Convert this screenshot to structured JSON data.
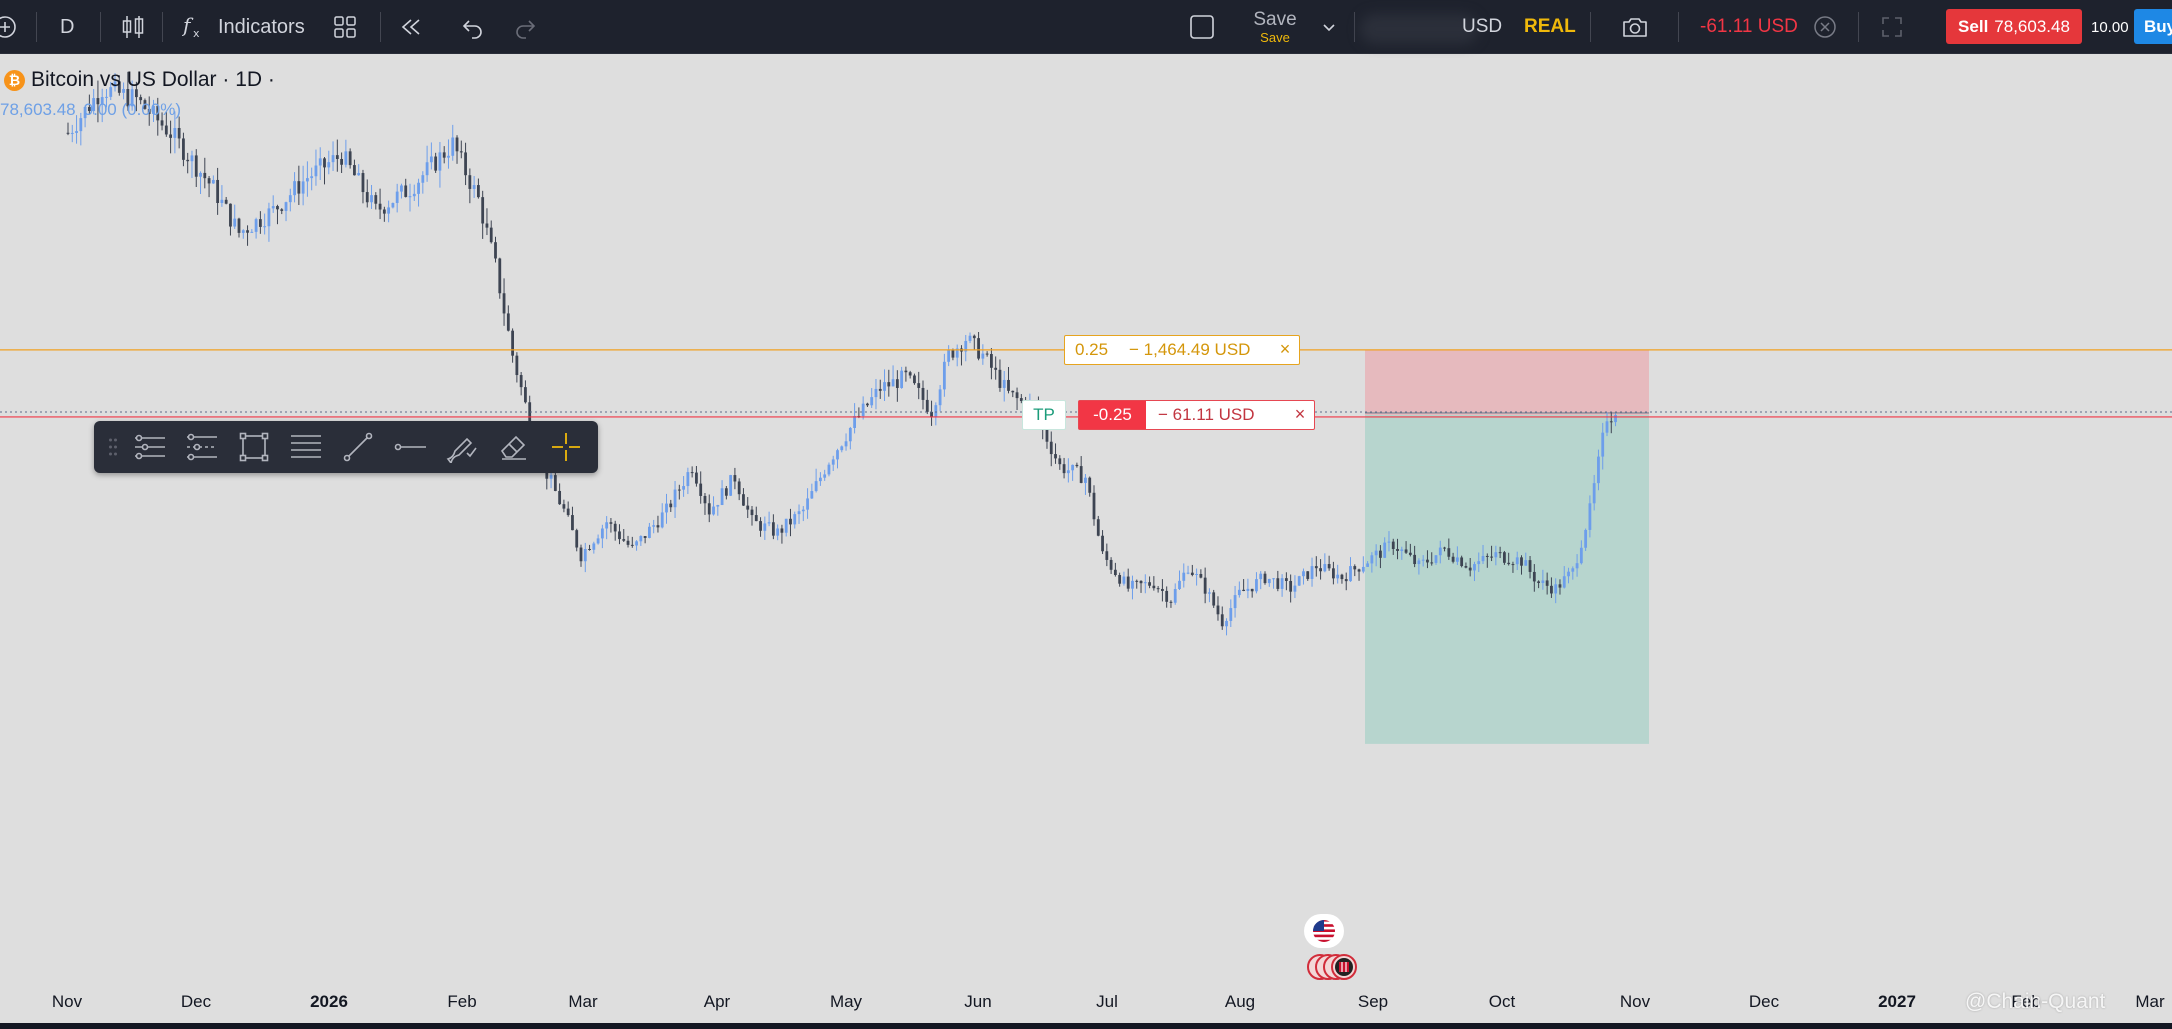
{
  "toolbar": {
    "timeframe": "D",
    "indicators_label": "Indicators",
    "save_label": "Save",
    "save_sublabel": "Save",
    "balance_suffix": "USD",
    "account_mode": "REAL",
    "pnl": "-61.11 USD",
    "sell_label": "Sell",
    "sell_price": "78,603.48",
    "lot": "10.00",
    "buy_label": "Buy"
  },
  "legend": {
    "title": "Bitcoin vs US Dollar · 1D ·",
    "coin_glyph": "₿",
    "price": "78,603.48",
    "change": "0.00 (0.00%)"
  },
  "orders": {
    "stop": {
      "qty": "0.25",
      "pnl": "− 1,464.49 USD",
      "close": "×"
    },
    "position": {
      "tag": "TP",
      "qty": "-0.25",
      "pnl": "− 61.11 USD",
      "close": "×"
    }
  },
  "colors": {
    "background": "#dedede",
    "toolbar": "#1e222d",
    "candle_up": "#6d9eeb",
    "candle_down": "#3d4452",
    "stop_line": "#f0a020",
    "position_line": "#f23645",
    "loss_zone": "#e8b4b8",
    "profit_zone": "#b3d4cc"
  },
  "drawing_tools": [
    "channel-icon",
    "pitchfork-icon",
    "rectangle-icon",
    "fib-icon",
    "trend-line-icon",
    "ray-icon",
    "brush-icon",
    "eraser-icon",
    "crosshair-icon"
  ],
  "events": {
    "flag": "us-flag-icon"
  },
  "watermark": "@Chain-Quant",
  "chart_data": {
    "type": "candlestick",
    "x_ticks": [
      {
        "label": "Nov",
        "bold": false
      },
      {
        "label": "Dec",
        "bold": false
      },
      {
        "label": "2026",
        "bold": true
      },
      {
        "label": "Feb",
        "bold": false
      },
      {
        "label": "Mar",
        "bold": false
      },
      {
        "label": "Apr",
        "bold": false
      },
      {
        "label": "May",
        "bold": false
      },
      {
        "label": "Jun",
        "bold": false
      },
      {
        "label": "Jul",
        "bold": false
      },
      {
        "label": "Aug",
        "bold": false
      },
      {
        "label": "Sep",
        "bold": false
      },
      {
        "label": "Oct",
        "bold": false
      },
      {
        "label": "Nov",
        "bold": false
      },
      {
        "label": "Dec",
        "bold": false
      },
      {
        "label": "2027",
        "bold": true
      },
      {
        "label": "Feb",
        "bold": false
      },
      {
        "label": "Mar",
        "bold": false
      }
    ],
    "path": [
      [
        0,
        104000
      ],
      [
        8,
        108000
      ],
      [
        16,
        107000
      ],
      [
        24,
        104000
      ],
      [
        34,
        99000
      ],
      [
        40,
        95000
      ],
      [
        48,
        97000
      ],
      [
        56,
        100000
      ],
      [
        64,
        102000
      ],
      [
        72,
        97000
      ],
      [
        80,
        99000
      ],
      [
        90,
        103000
      ],
      [
        96,
        98000
      ],
      [
        100,
        92000
      ],
      [
        104,
        84000
      ],
      [
        110,
        75000
      ],
      [
        116,
        70000
      ],
      [
        120,
        66000
      ],
      [
        126,
        69000
      ],
      [
        132,
        66500
      ],
      [
        140,
        70000
      ],
      [
        146,
        74000
      ],
      [
        150,
        70000
      ],
      [
        156,
        73000
      ],
      [
        160,
        69000
      ],
      [
        166,
        68000
      ],
      [
        172,
        70000
      ],
      [
        178,
        74500
      ],
      [
        184,
        78000
      ],
      [
        190,
        81000
      ],
      [
        196,
        82000
      ],
      [
        202,
        79000
      ],
      [
        206,
        84000
      ],
      [
        210,
        85500
      ],
      [
        214,
        84000
      ],
      [
        220,
        80500
      ],
      [
        226,
        79000
      ],
      [
        232,
        74000
      ],
      [
        238,
        73000
      ],
      [
        242,
        66000
      ],
      [
        248,
        63000
      ],
      [
        254,
        63500
      ],
      [
        258,
        62000
      ],
      [
        262,
        65000
      ],
      [
        266,
        63000
      ],
      [
        270,
        60000
      ],
      [
        274,
        62500
      ],
      [
        280,
        64000
      ],
      [
        286,
        63000
      ],
      [
        292,
        65000
      ],
      [
        298,
        64000
      ],
      [
        304,
        65500
      ],
      [
        310,
        67000
      ],
      [
        316,
        65000
      ],
      [
        322,
        66500
      ],
      [
        328,
        65000
      ],
      [
        334,
        66000
      ],
      [
        340,
        65500
      ],
      [
        344,
        63500
      ],
      [
        348,
        63000
      ],
      [
        352,
        64500
      ],
      [
        356,
        70000
      ],
      [
        360,
        78500
      ],
      [
        362,
        78603
      ]
    ],
    "current_price": 78603.48,
    "stop_price": 84460,
    "take_profit_price": 49000
  }
}
